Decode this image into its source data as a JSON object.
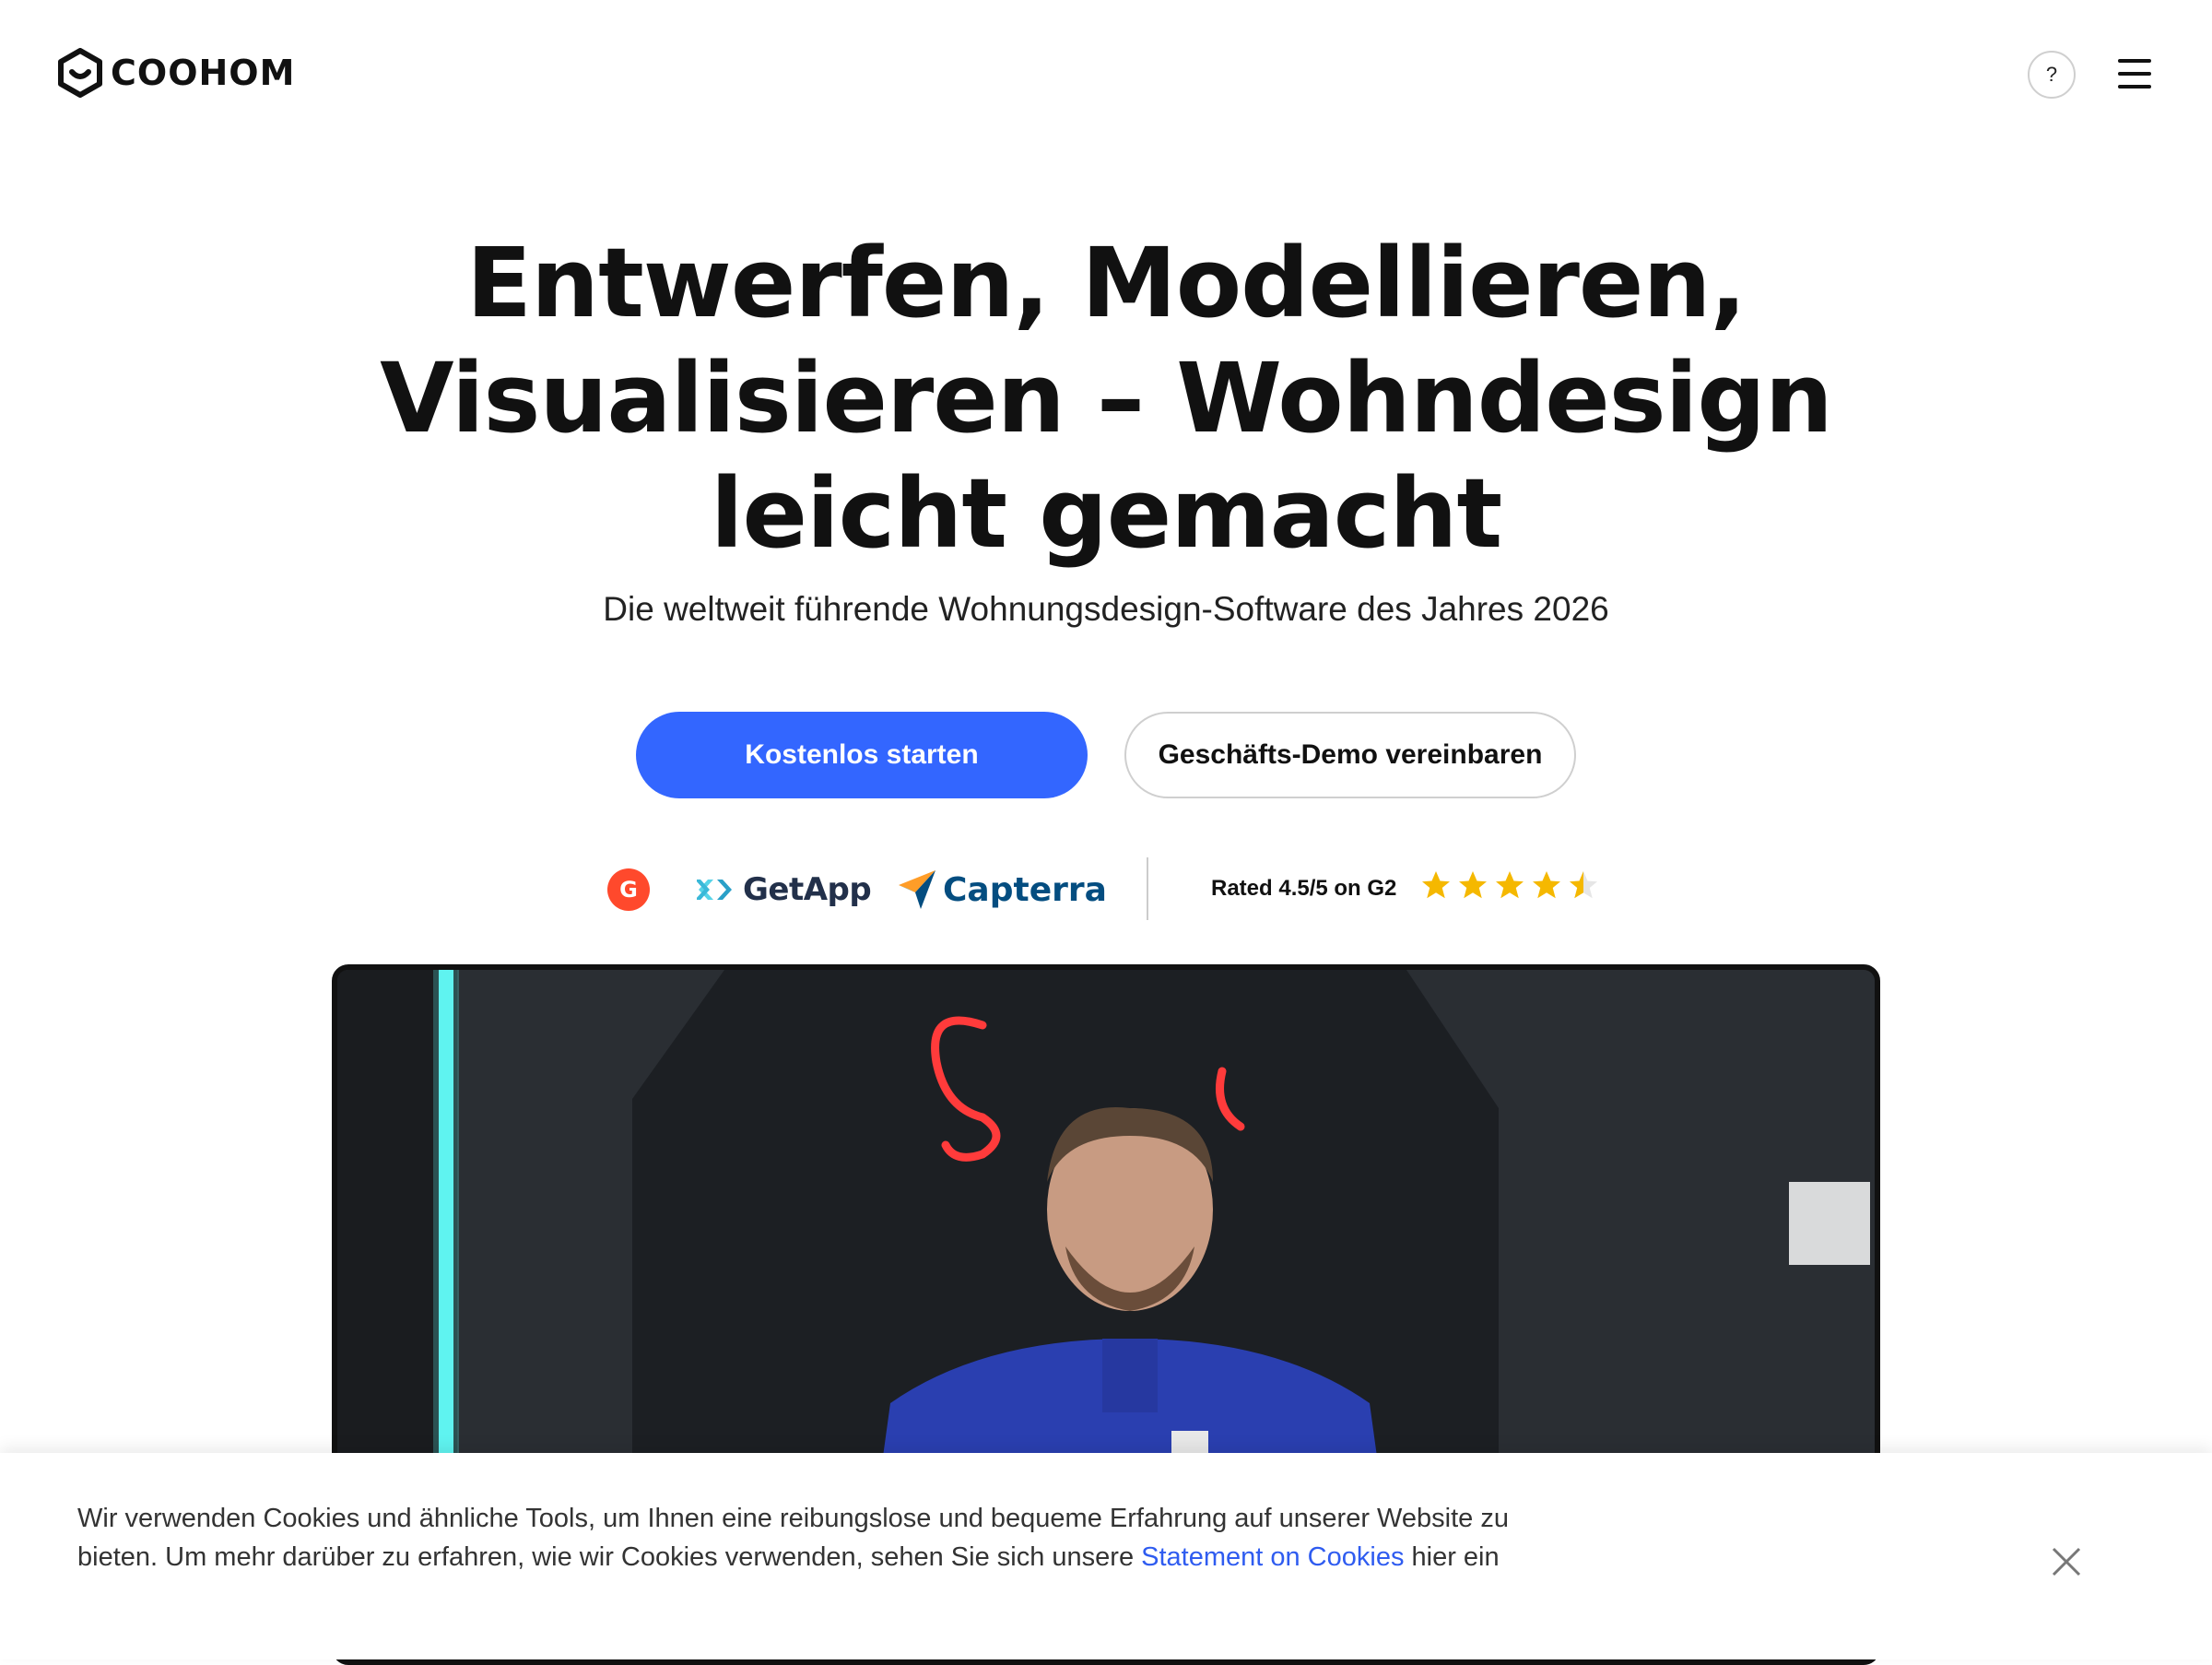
{
  "header": {
    "brand": "COOHOM",
    "help_label": "?"
  },
  "hero": {
    "title_lines": [
      "Entwerfen, Modellieren,",
      "Visualisieren – Wohndesign",
      "leicht gemacht"
    ],
    "subtitle": "Die weltweit führende Wohnungsdesign-Software des Jahres 2026",
    "primary_cta": "Kostenlos starten",
    "secondary_cta": "Geschäfts-Demo vereinbaren"
  },
  "ratings": {
    "g2_badge": "G",
    "getapp_label": "GetApp",
    "capterra_label": "Capterra",
    "rated_text": "Rated 4.5/5 on G2",
    "stars": 4.5,
    "star_color": "#f5b800"
  },
  "colors": {
    "accent": "#3366ff",
    "link": "#2f5cf0",
    "g2": "#ff492c",
    "getapp": "#22304a",
    "capterra": "#044d80"
  },
  "cookie_banner": {
    "text_before": "Wir verwenden Cookies und ähnliche Tools, um Ihnen eine reibungslose und bequeme Erfahrung auf unserer Website zu bieten. Um mehr darüber zu erfahren, wie wir Cookies verwenden, sehen Sie sich unsere ",
    "link_text": "Statement on Cookies",
    "text_after": " hier ein"
  },
  "icons": {
    "logo": "coohom-logo-icon",
    "help": "help-icon",
    "menu": "hamburger-menu-icon",
    "close": "close-icon",
    "star": "star-icon"
  }
}
